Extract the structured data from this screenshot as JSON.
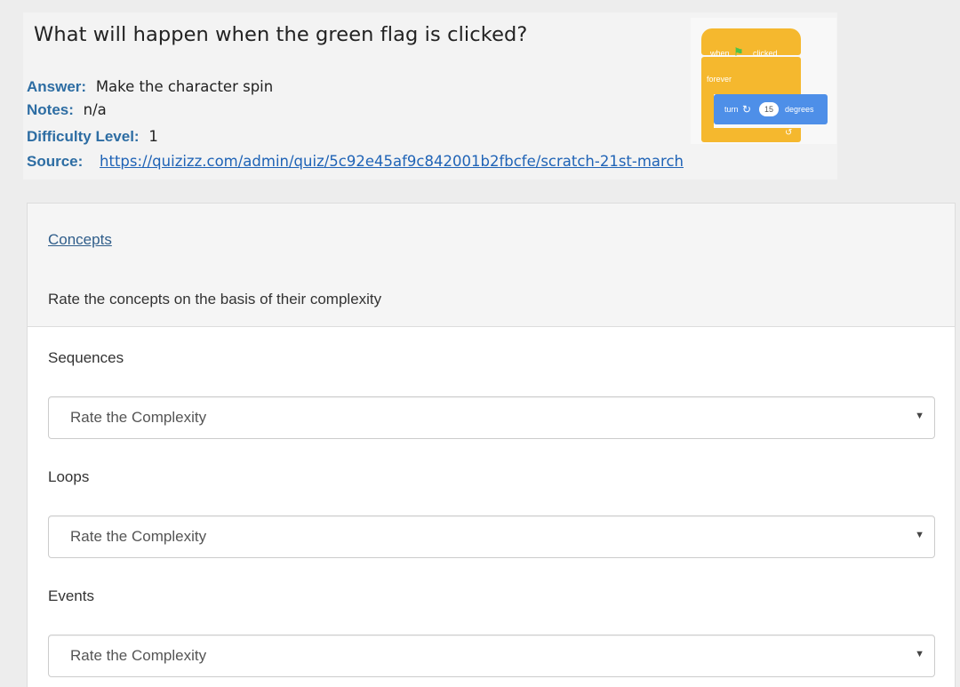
{
  "question": {
    "title": "What will happen when the green flag is clicked?",
    "answer_label": "Answer:",
    "answer_value": "Make the character spin",
    "notes_label": "Notes:",
    "notes_value": "n/a",
    "difficulty_label": "Difficulty Level:",
    "difficulty_value": "1",
    "source_label": "Source:",
    "source_url": "https://quizizz.com/admin/quiz/5c92e45af9c842001b2fbcfe/scratch-21st-march"
  },
  "scratch": {
    "when_text": "when",
    "flag_icon": "green-flag-icon",
    "clicked_text": "clicked",
    "forever_text": "forever",
    "turn_text": "turn",
    "degrees_value": "15",
    "degrees_text": "degrees",
    "colors": {
      "control": "#f5b82e",
      "motion": "#4e8fe8",
      "flag": "#4cc24a"
    }
  },
  "panel": {
    "heading_link": "Concepts",
    "description": "Rate the concepts on the basis of their complexity",
    "concepts": [
      {
        "label": "Sequences",
        "select_value": "Rate the Complexity"
      },
      {
        "label": "Loops",
        "select_value": "Rate the Complexity"
      },
      {
        "label": "Events",
        "select_value": "Rate the Complexity"
      }
    ]
  }
}
